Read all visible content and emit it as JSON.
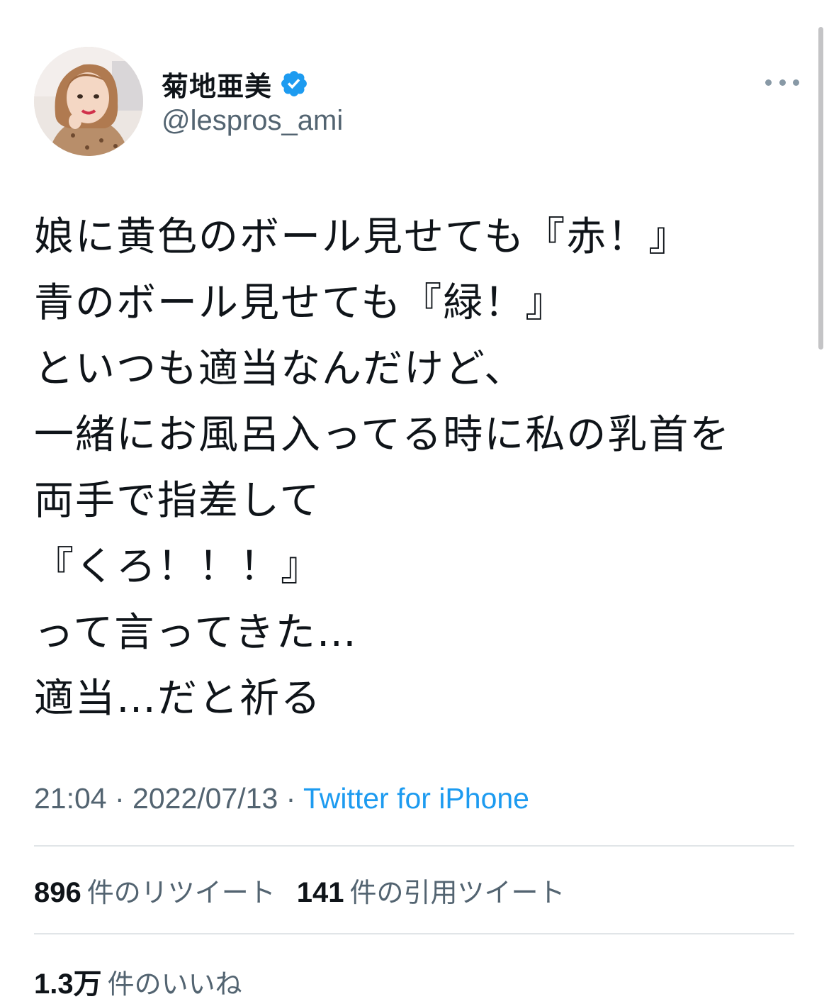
{
  "user": {
    "display_name": "菊地亜美",
    "handle": "@lespros_ami",
    "verified": true
  },
  "tweet": {
    "lines": [
      "娘に黄色のボール見せても『赤！』",
      "青のボール見せても『緑！』",
      "といつも適当なんだけど、",
      "一緒にお風呂入ってる時に私の乳首を",
      "両手で指差して",
      "『くろ！！！』",
      "って言ってきた…",
      "適当…だと祈る"
    ]
  },
  "meta": {
    "time": "21:04",
    "separator": " · ",
    "date": "2022/07/13",
    "source": "Twitter for iPhone"
  },
  "stats": {
    "retweets": {
      "count": "896",
      "label": "件のリツイート"
    },
    "quotes": {
      "count": "141",
      "label": "件の引用ツイート"
    },
    "likes": {
      "count": "1.3万",
      "label": "件のいいね"
    }
  },
  "colors": {
    "text": "#0f1419",
    "secondary": "#536471",
    "link": "#1d9bf0",
    "verified": "#1d9bf0",
    "divider": "#e1e5e8"
  },
  "icons": {
    "verified": "verified-badge-icon",
    "more": "more-dots-icon"
  }
}
